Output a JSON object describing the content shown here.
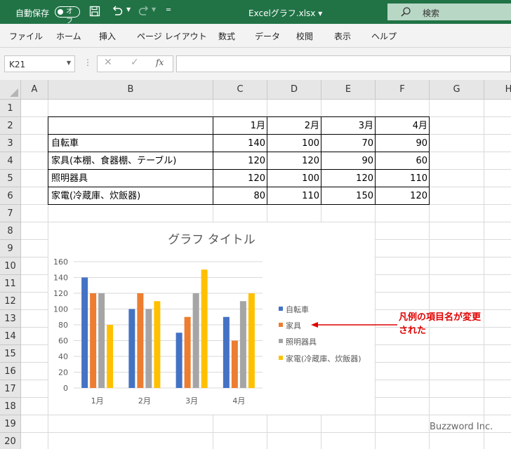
{
  "titlebar": {
    "autosave_label": "自動保存",
    "autosave_state": "オフ",
    "filename": "Excelグラフ.xlsx",
    "search_placeholder": "検索"
  },
  "menu": [
    "ファイル",
    "ホーム",
    "挿入",
    "ページ レイアウト",
    "数式",
    "データ",
    "校閲",
    "表示",
    "ヘルプ"
  ],
  "formula_bar": {
    "name_box": "K21",
    "fx_label": "fx",
    "formula": ""
  },
  "columns": [
    "A",
    "B",
    "C",
    "D",
    "E",
    "F",
    "G",
    "H"
  ],
  "rows": [
    "1",
    "2",
    "3",
    "4",
    "5",
    "6",
    "7",
    "8",
    "9",
    "10",
    "11",
    "12",
    "13",
    "14",
    "15",
    "16",
    "17",
    "18",
    "19",
    "20"
  ],
  "table": {
    "headers": [
      "1月",
      "2月",
      "3月",
      "4月"
    ],
    "rows": [
      {
        "label": "自転車",
        "values": [
          "140",
          "100",
          "70",
          "90"
        ]
      },
      {
        "label": "家具(本棚、食器棚、テーブル)",
        "values": [
          "120",
          "120",
          "90",
          "60"
        ]
      },
      {
        "label": "照明器具",
        "values": [
          "120",
          "100",
          "120",
          "110"
        ]
      },
      {
        "label": "家電(冷蔵庫、炊飯器)",
        "values": [
          "80",
          "110",
          "150",
          "120"
        ]
      }
    ]
  },
  "chart_data": {
    "type": "bar",
    "title": "グラフ タイトル",
    "categories": [
      "1月",
      "2月",
      "3月",
      "4月"
    ],
    "series": [
      {
        "name": "自転車",
        "values": [
          140,
          100,
          70,
          90
        ],
        "color": "#4472C4"
      },
      {
        "name": "家具",
        "values": [
          120,
          120,
          90,
          60
        ],
        "color": "#ED7D31"
      },
      {
        "name": "照明器具",
        "values": [
          120,
          100,
          120,
          110
        ],
        "color": "#A5A5A5"
      },
      {
        "name": "家電(冷蔵庫、炊飯器)",
        "values": [
          80,
          110,
          150,
          120
        ],
        "color": "#FFC000"
      }
    ],
    "ylim": [
      0,
      160
    ],
    "yticks": [
      "0",
      "20",
      "40",
      "60",
      "80",
      "100",
      "120",
      "140",
      "160"
    ],
    "grid": true,
    "legend_position": "right"
  },
  "annotation": {
    "line1": "凡例の項目名が変更",
    "line2": "された",
    "color": "#E00000"
  },
  "watermark": "Buzzword Inc.",
  "colors": {
    "excel_green": "#217346"
  }
}
